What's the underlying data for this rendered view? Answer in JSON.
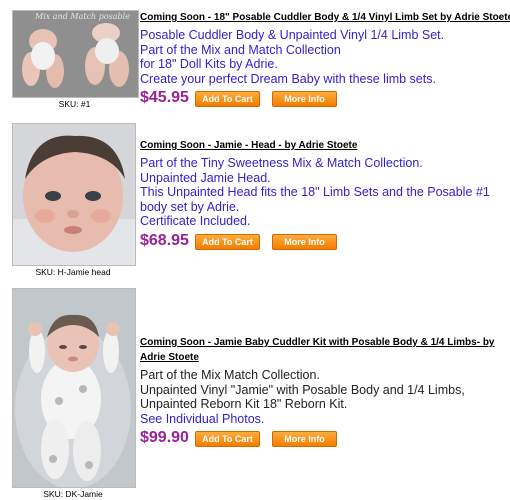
{
  "buttons": {
    "add_to_cart": "Add To Cart",
    "more_info": "More Info"
  },
  "products": [
    {
      "title": "Coming Soon - 18\" Posable Cuddler Body & 1/4 Vinyl Limb Set by Adrie Stoete",
      "description": [
        "Posable Cuddler Body & Unpainted Vinyl 1/4 Limb Set.",
        "Part of the Mix and Match Collection",
        "for 18\" Doll Kits by Adrie.",
        "Create your perfect Dream Baby with these limb sets."
      ],
      "price": "$45.95",
      "sku": "SKU: #1",
      "image_watermark": "Mix and Match posable"
    },
    {
      "title": "Coming Soon - Jamie - Head - by Adrie Stoete",
      "description": [
        "Part of the Tiny Sweetness Mix & Match Collection.",
        "Unpainted Jamie Head.",
        "This Unpainted Head fits the 18\" Limb Sets and the Posable #1",
        "body set by Adrie.",
        "Certificate Included."
      ],
      "price": "$68.95",
      "sku": "SKU: H-Jamie head"
    },
    {
      "title": "Coming Soon - Jamie Baby Cuddler Kit with Posable Body & 1/4 Limbs- by Adrie Stoete",
      "description": [
        "Part of the Mix Match Collection.",
        "Unpainted Vinyl \"Jamie\" with Posable Body and 1/4 Limbs,",
        "Unpainted Reborn Kit 18\" Reborn Kit."
      ],
      "link": "See Individual Photos.",
      "price": "$99.90",
      "sku": "SKU: DK-Jamie"
    }
  ],
  "colors": {
    "description_text": "#3322cc",
    "price": "#992299",
    "button": "#f58a0c"
  }
}
